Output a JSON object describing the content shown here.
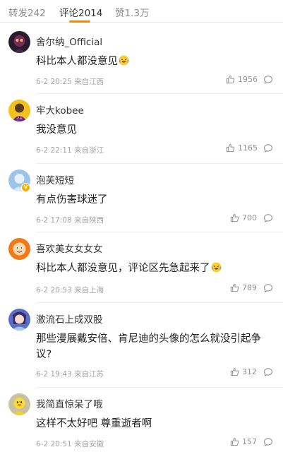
{
  "tabs": [
    {
      "label": "转发242",
      "active": false
    },
    {
      "label": "评论2014",
      "active": true
    },
    {
      "label": "赞1.3万",
      "active": false
    }
  ],
  "accent_color": "#ff8200",
  "comments": [
    {
      "username": "舍尔纳_Official",
      "text": "科比本人都没意见",
      "emoji": "laughing-tears-emoji",
      "time": "6-2 20:25 来自江西",
      "likes": "1956",
      "avatar": "dark-avatar-icon",
      "verified": false
    },
    {
      "username": "牢大kobee",
      "text": "我没意见",
      "emoji": "",
      "time": "6-2 22:11 来自浙江",
      "likes": "1165",
      "avatar": "player-avatar-icon",
      "verified": false
    },
    {
      "username": "泡芙短短",
      "text": "有点伤害球迷了",
      "emoji": "",
      "time": "6-2 17:08 来自陕西",
      "likes": "700",
      "avatar": "blue-avatar-icon",
      "verified": true
    },
    {
      "username": "喜欢美女女女女",
      "text": "科比本人都没意见，评论区先急起来了",
      "emoji": "laughing-tears-emoji",
      "time": "6-2 20:53 来自上海",
      "likes": "789",
      "avatar": "cartoon-avatar-icon",
      "verified": false
    },
    {
      "username": "激流石上成双股",
      "text": "那些漫展戴安倍、肯尼迪的头像的怎么就没引起争议?",
      "emoji": "",
      "time": "6-2 19:43 来自江苏",
      "likes": "312",
      "avatar": "anime-avatar-icon",
      "verified": false
    },
    {
      "username": "我简直惊呆了哦",
      "text": "这样不太好吧 尊重逝者啊",
      "emoji": "",
      "time": "6-2 20:51 来自安徽",
      "likes": "157",
      "avatar": "duck-avatar-icon",
      "verified": false
    }
  ]
}
